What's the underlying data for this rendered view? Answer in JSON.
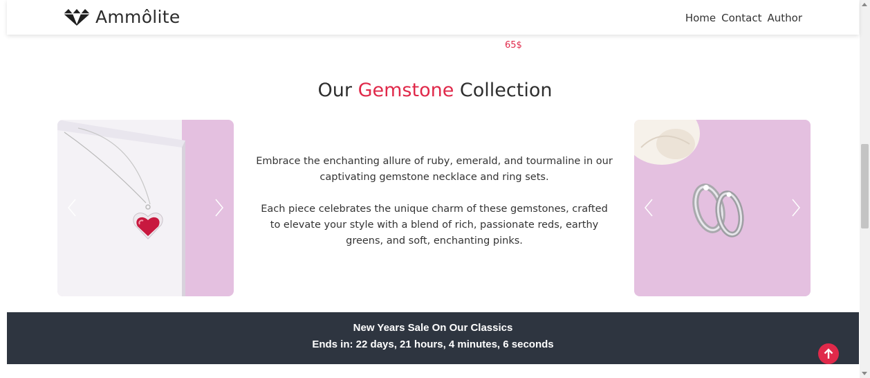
{
  "navbar": {
    "brand": "Ammôlite",
    "links": [
      "Home",
      "Contact",
      "Author"
    ]
  },
  "peek_product": {
    "price": "65$"
  },
  "collection": {
    "title_before": "Our ",
    "title_accent": "Gemstone",
    "title_after": " Collection",
    "paragraph_1": "Embrace the enchanting allure of ruby, emerald, and tourmaline in our captivating gemstone necklace and ring sets.",
    "paragraph_2": "Each piece celebrates the unique charm of these gemstones, crafted to elevate your style with a blend of rich, passionate reds, earthy greens, and soft, enchanting pinks."
  },
  "sale": {
    "title": "New Years Sale On Our Classics",
    "countdown": "Ends in: 22 days, 21 hours, 4 minutes, 6 seconds"
  },
  "colors": {
    "accent": "#e0294a",
    "banner": "#2e3540",
    "photo_pink": "#e4c0e0"
  },
  "icons": {
    "brand": "diamond-icon",
    "carousel_prev": "chevron-left-icon",
    "carousel_next": "chevron-right-icon",
    "to_top": "arrow-up-icon"
  }
}
